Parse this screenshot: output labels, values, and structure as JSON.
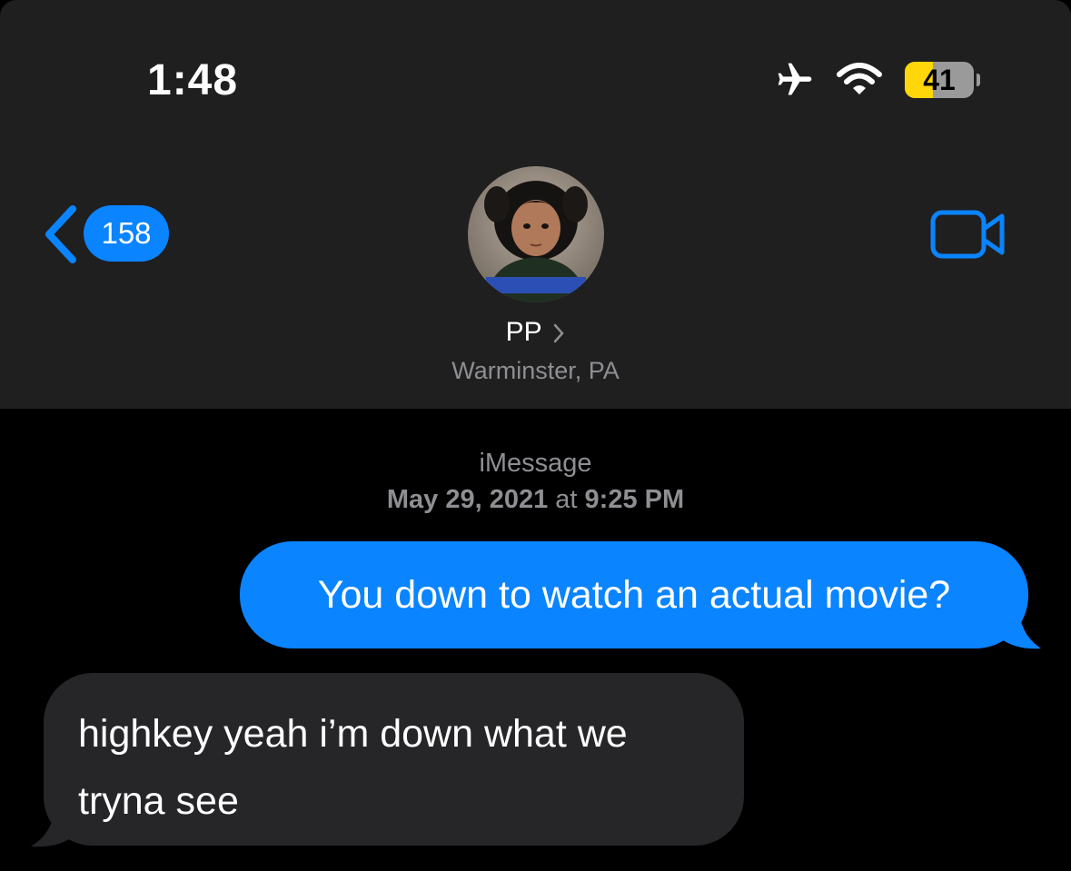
{
  "status_bar": {
    "time": "1:48",
    "battery_level": "41",
    "battery_fraction": 0.41,
    "icons": [
      "airplane-icon",
      "wifi-icon",
      "battery-icon"
    ]
  },
  "nav": {
    "back_count": "158",
    "contact_name": "PP",
    "contact_location": "Warminster, PA",
    "facetime_icon": "video-camera-icon"
  },
  "conversation": {
    "service": "iMessage",
    "date": "May 29, 2021",
    "at_word": "at",
    "time": "9:25 PM",
    "messages": [
      {
        "direction": "outgoing",
        "text": "You down to watch an actual movie?"
      },
      {
        "direction": "incoming",
        "line1": "highkey yeah i’m down what we",
        "line2": "tryna see"
      }
    ]
  },
  "colors": {
    "accent": "#0a84ff",
    "header_bg": "#1f1f1f",
    "incoming_bubble": "#262629",
    "secondary_text": "#8e8e93"
  }
}
